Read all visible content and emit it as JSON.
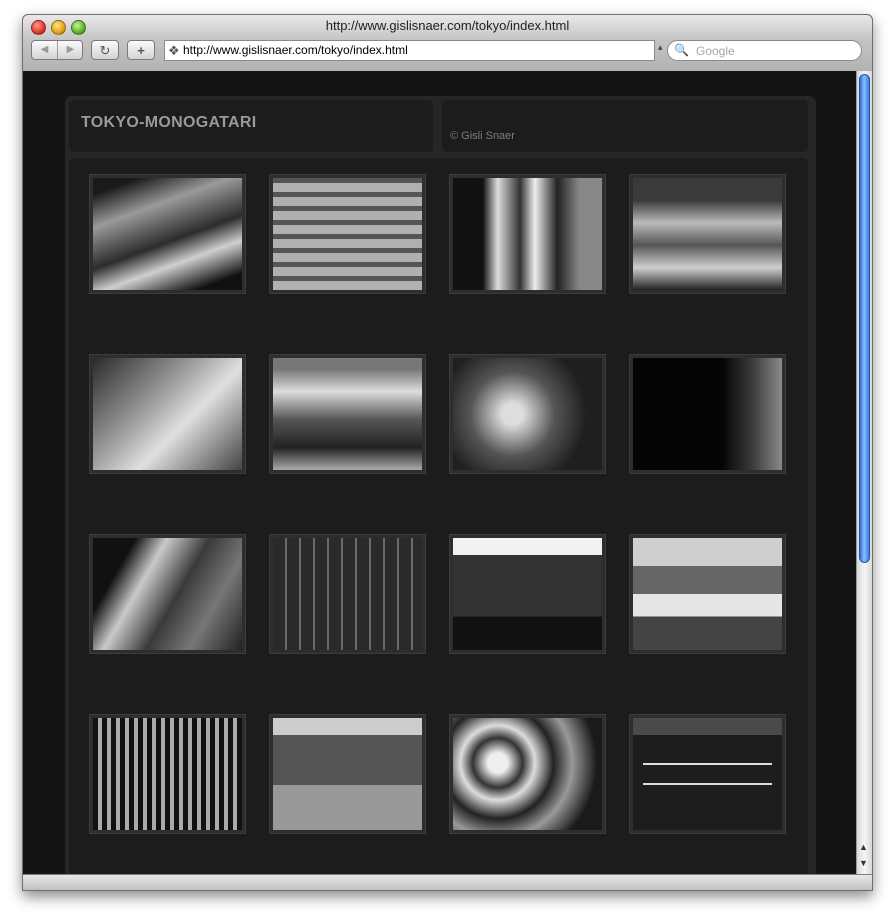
{
  "window": {
    "title": "http://www.gislisnaer.com/tokyo/index.html"
  },
  "toolbar": {
    "back_icon": "◀",
    "forward_icon": "▶",
    "reload_icon": "↻",
    "add_bookmark_icon": "+",
    "url": "http://www.gislisnaer.com/tokyo/index.html",
    "url_icon": "❖",
    "url_menu_icon": "▴",
    "search_placeholder": "Google",
    "search_icon": "🔍"
  },
  "page": {
    "site_title": "TOKYO-MONOGATARI",
    "copyright": "© Gisli Snaer",
    "photos": [
      {
        "row": 1,
        "col": 1
      },
      {
        "row": 1,
        "col": 2
      },
      {
        "row": 1,
        "col": 3
      },
      {
        "row": 1,
        "col": 4
      },
      {
        "row": 2,
        "col": 1
      },
      {
        "row": 2,
        "col": 2
      },
      {
        "row": 2,
        "col": 3
      },
      {
        "row": 2,
        "col": 4
      },
      {
        "row": 3,
        "col": 1
      },
      {
        "row": 3,
        "col": 2
      },
      {
        "row": 3,
        "col": 3
      },
      {
        "row": 3,
        "col": 4
      },
      {
        "row": 4,
        "col": 1
      },
      {
        "row": 4,
        "col": 2
      },
      {
        "row": 4,
        "col": 3
      },
      {
        "row": 4,
        "col": 4
      }
    ]
  },
  "scrollbar": {
    "up_icon": "▲",
    "down_icon": "▼"
  }
}
